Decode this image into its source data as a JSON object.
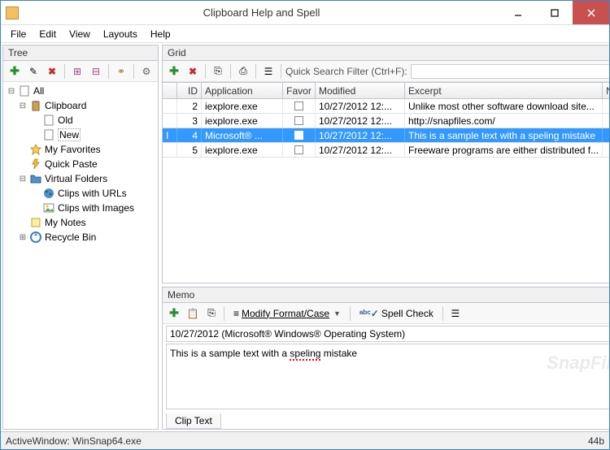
{
  "window": {
    "title": "Clipboard Help and Spell"
  },
  "menu": {
    "file": "File",
    "edit": "Edit",
    "view": "View",
    "layouts": "Layouts",
    "help": "Help"
  },
  "panels": {
    "tree": "Tree",
    "grid": "Grid",
    "memo": "Memo"
  },
  "tree": {
    "all": "All",
    "clipboard": "Clipboard",
    "old": "Old",
    "new": "New",
    "favorites": "My Favorites",
    "quickpaste": "Quick Paste",
    "virtualfolders": "Virtual Folders",
    "clipsurls": "Clips with URLs",
    "clipsimages": "Clips with Images",
    "mynotes": "My Notes",
    "recyclebin": "Recycle Bin"
  },
  "grid": {
    "quicksearch_label": "Quick Search Filter (Ctrl+F):",
    "columns": {
      "id": "ID",
      "application": "Application",
      "favor": "Favor",
      "modified": "Modified",
      "excerpt": "Excerpt",
      "notes": "Notes"
    },
    "rows": [
      {
        "id": "2",
        "app": "iexplore.exe",
        "fav": false,
        "modified": "10/27/2012 12:...",
        "excerpt": "Unlike most other software download site...",
        "notes": ""
      },
      {
        "id": "3",
        "app": "iexplore.exe",
        "fav": false,
        "modified": "10/27/2012 12:...",
        "excerpt": "http://snapfiles.com/",
        "notes": ""
      },
      {
        "id": "4",
        "app": "Microsoft® ...",
        "fav": true,
        "modified": "10/27/2012 12:...",
        "excerpt": "This is a sample text with a speling mistake",
        "notes": ""
      },
      {
        "id": "5",
        "app": "iexplore.exe",
        "fav": false,
        "modified": "10/27/2012 12:...",
        "excerpt": "Freeware programs are either distributed f...",
        "notes": ""
      }
    ]
  },
  "memo": {
    "modifylabel": "Modify Format/Case",
    "spellcheck": "Spell Check",
    "title": "10/27/2012 (Microsoft® Windows® Operating System)",
    "body_pre": "This is a sample text with a ",
    "body_err": "speling",
    "body_post": " mistake",
    "tab": "Clip Text",
    "watermark": "SnapFiles"
  },
  "status": {
    "left": "ActiveWindow: WinSnap64.exe",
    "right": "44b"
  }
}
